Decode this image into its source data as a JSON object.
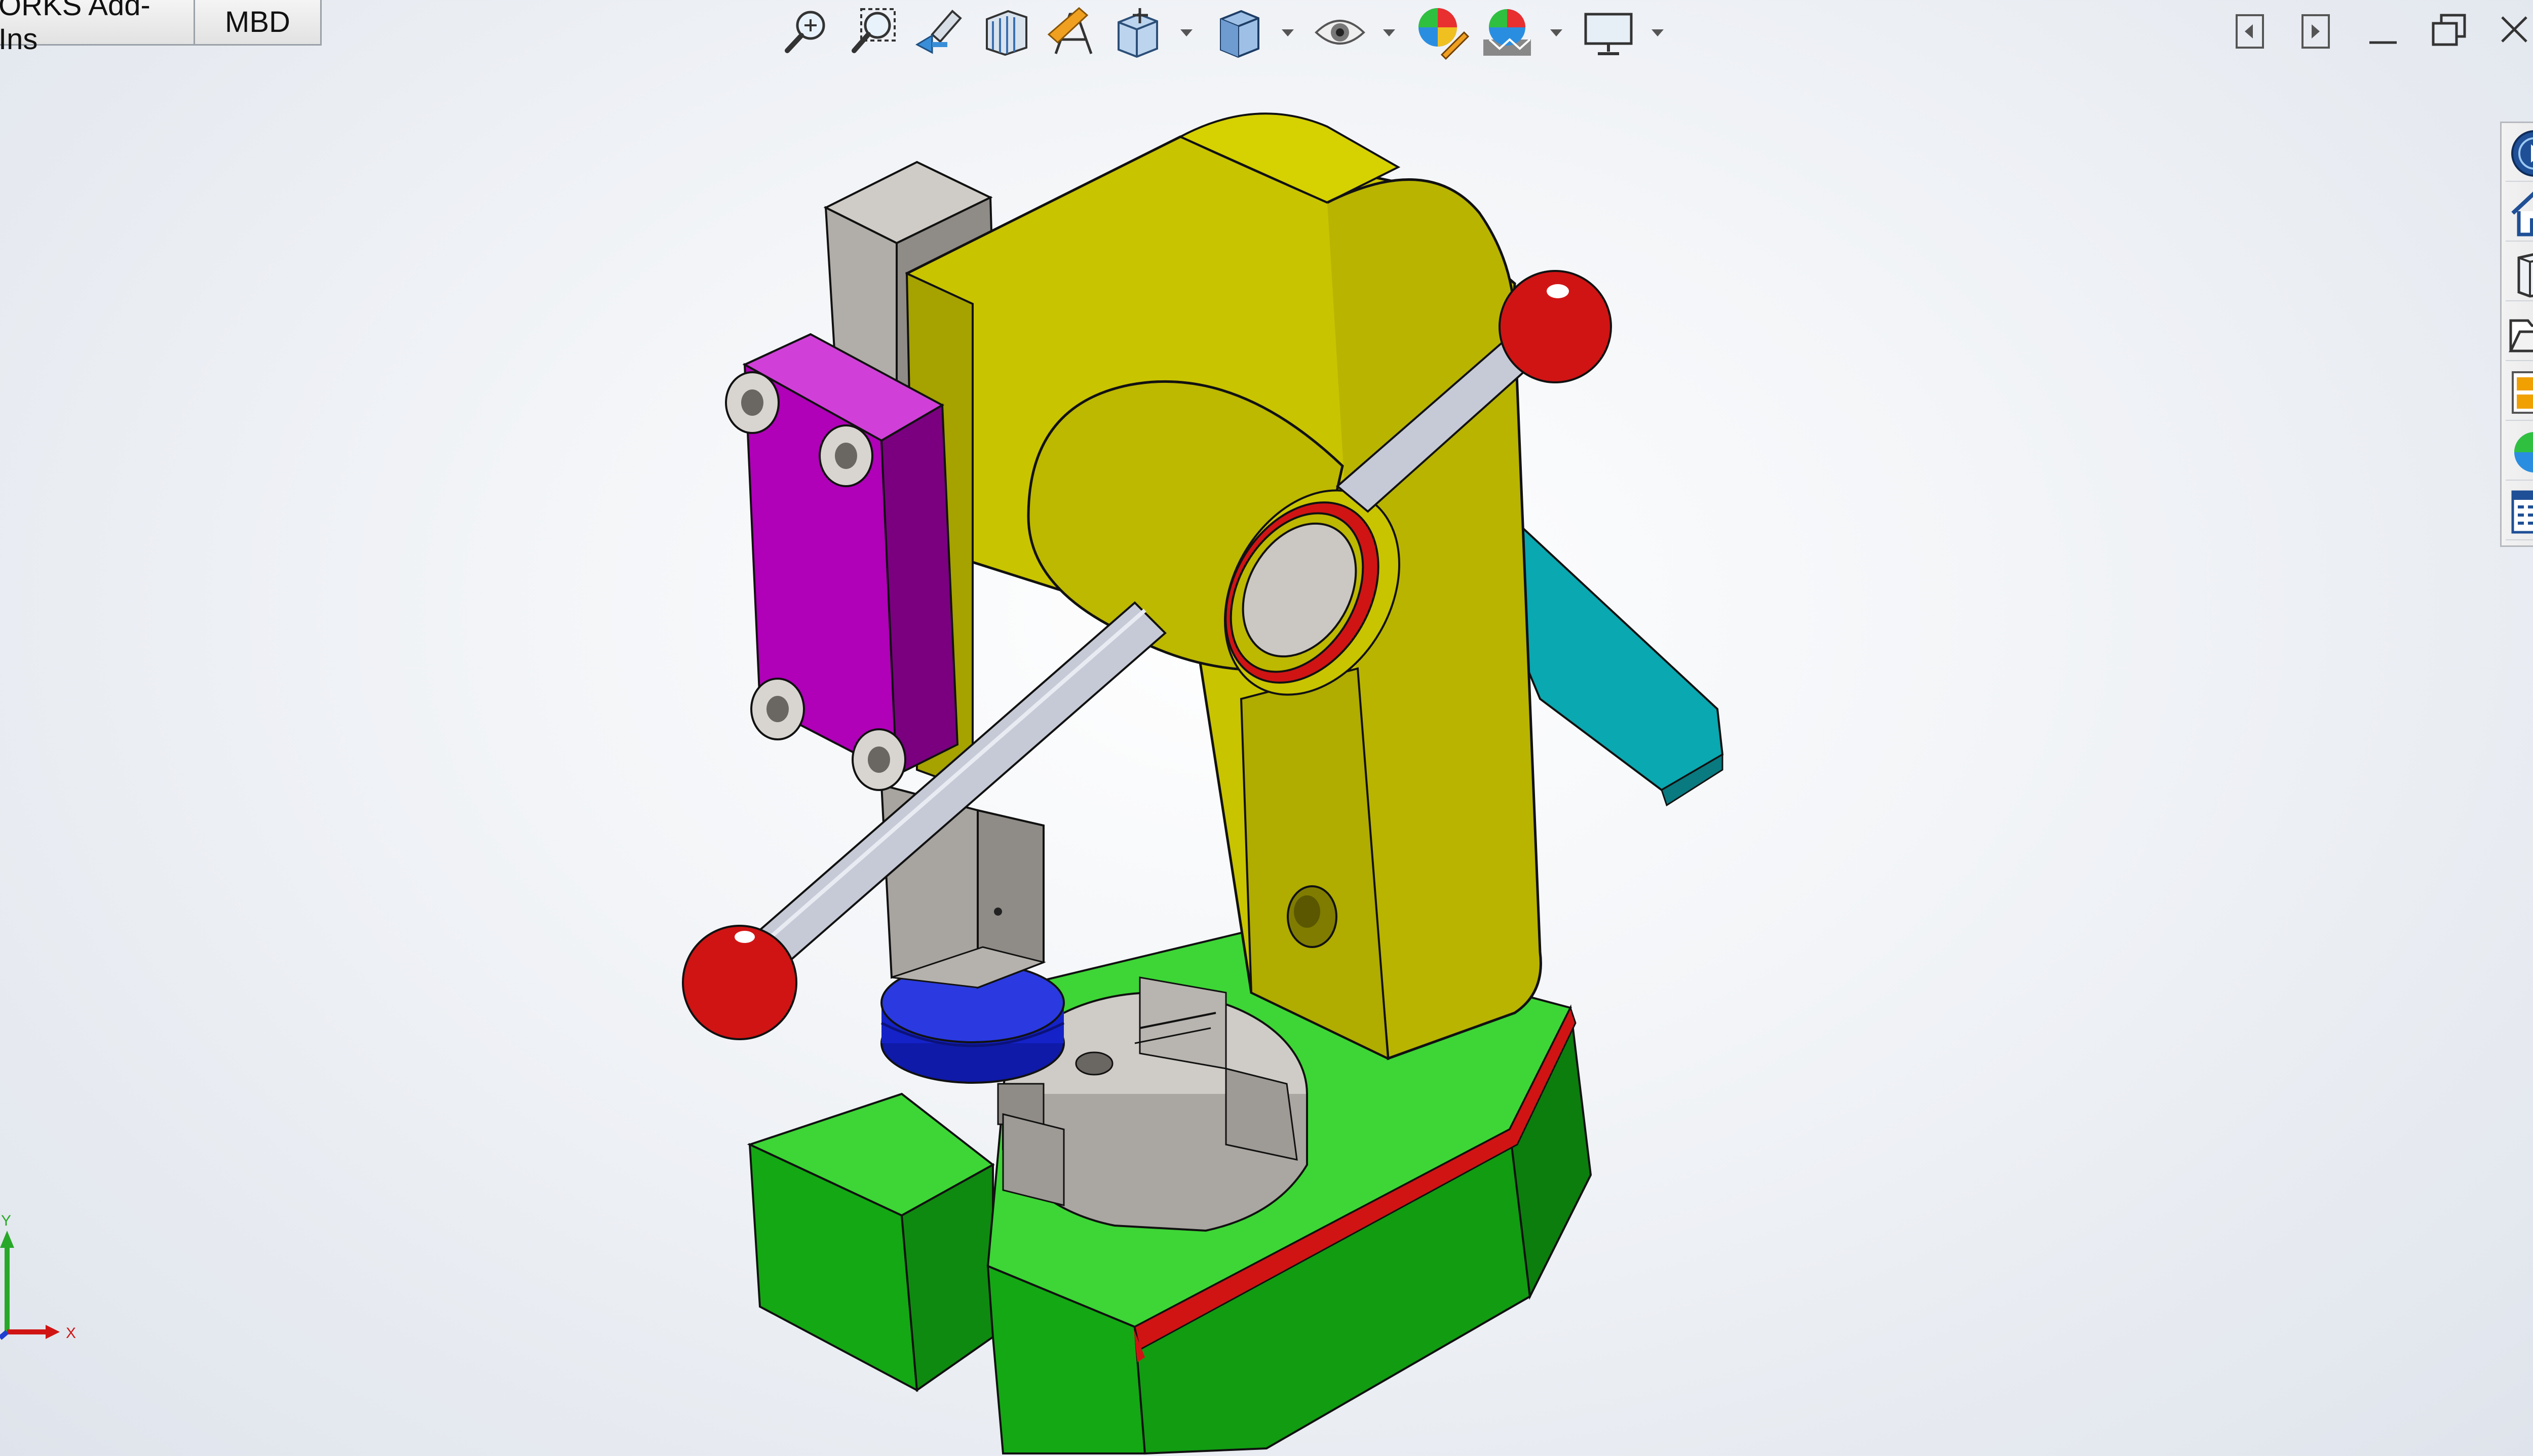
{
  "command_manager": {
    "tabs": [
      {
        "label": "ORKS Add-Ins"
      },
      {
        "label": "MBD"
      }
    ]
  },
  "heads_up_toolbar": {
    "items": [
      {
        "name": "zoom-to-fit-icon"
      },
      {
        "name": "zoom-to-area-icon"
      },
      {
        "name": "previous-view-icon"
      },
      {
        "name": "section-view-icon"
      },
      {
        "name": "dynamic-annotation-views-icon"
      },
      {
        "name": "view-orientation-icon",
        "dropdown": true
      },
      {
        "name": "display-style-icon",
        "dropdown": true
      },
      {
        "name": "hide-show-items-icon",
        "dropdown": true
      },
      {
        "name": "edit-appearance-icon"
      },
      {
        "name": "apply-scene-icon",
        "dropdown": true
      },
      {
        "name": "view-settings-icon",
        "dropdown": true
      }
    ]
  },
  "window_controls": {
    "items": [
      {
        "name": "tile-left-icon"
      },
      {
        "name": "tile-right-icon"
      },
      {
        "name": "minimize-icon"
      },
      {
        "name": "restore-icon"
      },
      {
        "name": "close-icon"
      }
    ]
  },
  "task_pane": {
    "items": [
      {
        "name": "solidworks-resources-icon"
      },
      {
        "name": "home-icon"
      },
      {
        "name": "design-library-icon"
      },
      {
        "name": "file-explorer-icon"
      },
      {
        "name": "view-palette-icon"
      },
      {
        "name": "appearances-scenes-icon"
      },
      {
        "name": "custom-properties-icon"
      }
    ]
  },
  "triad": {
    "y_label": "Y",
    "x_label": "X"
  },
  "colors": {
    "frame_yellow": "#c9c400",
    "base_green": "#22c21f",
    "accent_red": "#d01414",
    "plate_magenta": "#b000b8",
    "handle_cyan": "#0aa8b0",
    "button_blue": "#1422c8",
    "part_gray": "#bdbab6"
  }
}
